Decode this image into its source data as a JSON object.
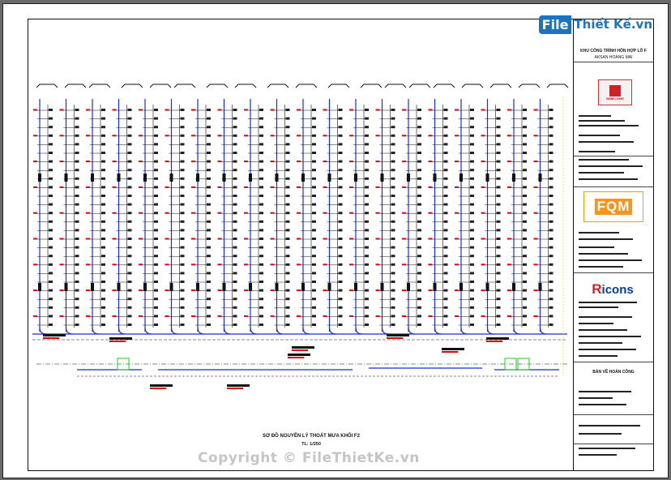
{
  "watermark": {
    "brand_file": "File",
    "brand_rest": "Thiết Kế.vn"
  },
  "copyright": "Copyright © FileThietKe.vn",
  "drawing": {
    "title": "SƠ ĐỒ NGUYÊN LÝ THOÁT MƯA KHỐI F2",
    "scale": "TL: 1/250"
  },
  "title_block": {
    "project": "KHU CÔNG TRÌNH HỖN HỢP LÔ F",
    "subtitle": "AKSAN HOÀNG MAI",
    "logos": {
      "namlong": "NAM LONG",
      "fqm": "FQM",
      "ricons_r": "R",
      "ricons_rest": "icons"
    },
    "sheet_label": "BẢN VẼ HOÀN CÔNG"
  },
  "colors": {
    "pipe": "#1a2fd8",
    "line": "#111111",
    "accent": "#e30000",
    "green": "#22cc22"
  }
}
